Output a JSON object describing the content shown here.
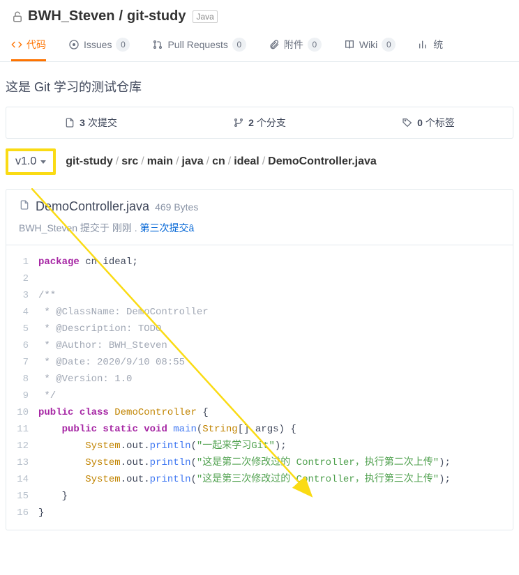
{
  "header": {
    "owner": "BWH_Steven",
    "sep": " / ",
    "repo": "git-study",
    "language": "Java"
  },
  "tabs": {
    "code": "代码",
    "issues": {
      "label": "Issues",
      "count": "0"
    },
    "pr": {
      "label": "Pull Requests",
      "count": "0"
    },
    "attach": {
      "label": "附件",
      "count": "0"
    },
    "wiki": {
      "label": "Wiki",
      "count": "0"
    },
    "stats": "统"
  },
  "description": "这是 Git 学习的测试仓库",
  "stats": {
    "commits_n": "3",
    "commits_t": " 次提交",
    "branches_n": "2",
    "branches_t": " 个分支",
    "tags_n": "0",
    "tags_t": " 个标签"
  },
  "branch": "v1.0",
  "breadcrumb": {
    "p0": "git-study",
    "p1": "src",
    "p2": "main",
    "p3": "java",
    "p4": "cn",
    "p5": "ideal",
    "p6": "DemoController.java",
    "sep": "/"
  },
  "file": {
    "name": "DemoController.java",
    "size": "469 Bytes",
    "author": "BWH_Steven",
    "meta_mid": " 提交于 ",
    "time": "刚刚",
    "dot": " . ",
    "commit_msg": "第三次提交â"
  },
  "code": {
    "l1": {
      "kw1": "package",
      "r": " cn.ideal;"
    },
    "l3": "/**",
    "l4": " * @ClassName: DemoController",
    "l5": " * @Description: TODO",
    "l6": " * @Author: BWH_Steven",
    "l7": " * @Date: 2020/9/10 08:55",
    "l8": " * @Version: 1.0",
    "l9": " */",
    "l10": {
      "kw1": "public",
      "kw2": " class ",
      "cls": "DemoController",
      "r": " {"
    },
    "l11": {
      "i": "    ",
      "kw1": "public",
      "kw2": " static",
      "kw3": " void ",
      "fn": "main",
      "r1": "(",
      "cls": "String",
      "r2": "[] args) {"
    },
    "l12": {
      "i": "        ",
      "c1": "System",
      "r1": ".out.",
      "fn": "println",
      "r2": "(",
      "s": "\"一起来学习Git\"",
      "r3": ");"
    },
    "l13": {
      "i": "        ",
      "c1": "System",
      "r1": ".out.",
      "fn": "println",
      "r2": "(",
      "s": "\"这是第二次修改过的 Controller，执行第二次上传\"",
      "r3": ");"
    },
    "l14": {
      "i": "        ",
      "c1": "System",
      "r1": ".out.",
      "fn": "println",
      "r2": "(",
      "s": "\"这是第三次修改过的 Controller，执行第三次上传\"",
      "r3": ");"
    },
    "l15": "    }",
    "l16": "}"
  },
  "lnums": {
    "1": "1",
    "2": "2",
    "3": "3",
    "4": "4",
    "5": "5",
    "6": "6",
    "7": "7",
    "8": "8",
    "9": "9",
    "10": "10",
    "11": "11",
    "12": "12",
    "13": "13",
    "14": "14",
    "15": "15",
    "16": "16"
  }
}
